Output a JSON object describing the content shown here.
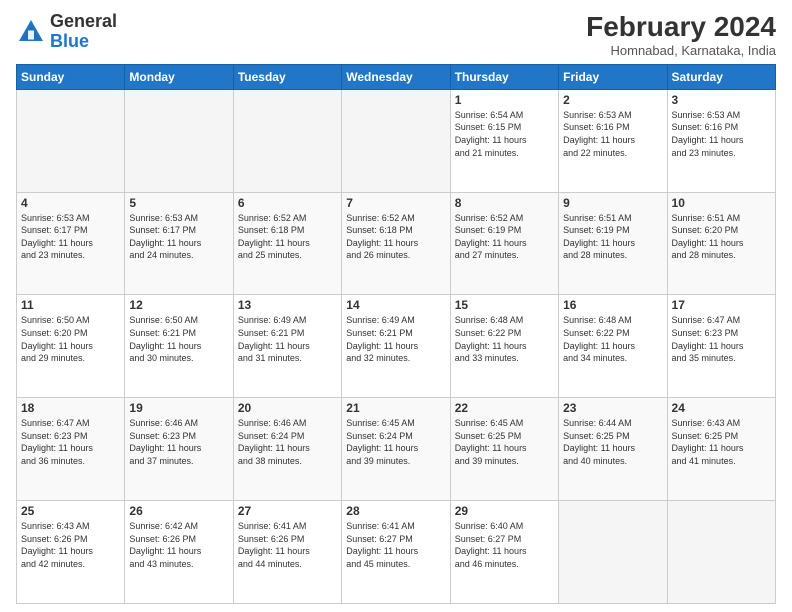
{
  "header": {
    "logo_general": "General",
    "logo_blue": "Blue",
    "month_year": "February 2024",
    "location": "Homnabad, Karnataka, India"
  },
  "days_of_week": [
    "Sunday",
    "Monday",
    "Tuesday",
    "Wednesday",
    "Thursday",
    "Friday",
    "Saturday"
  ],
  "weeks": [
    [
      {
        "day": "",
        "info": ""
      },
      {
        "day": "",
        "info": ""
      },
      {
        "day": "",
        "info": ""
      },
      {
        "day": "",
        "info": ""
      },
      {
        "day": "1",
        "info": "Sunrise: 6:54 AM\nSunset: 6:15 PM\nDaylight: 11 hours\nand 21 minutes."
      },
      {
        "day": "2",
        "info": "Sunrise: 6:53 AM\nSunset: 6:16 PM\nDaylight: 11 hours\nand 22 minutes."
      },
      {
        "day": "3",
        "info": "Sunrise: 6:53 AM\nSunset: 6:16 PM\nDaylight: 11 hours\nand 23 minutes."
      }
    ],
    [
      {
        "day": "4",
        "info": "Sunrise: 6:53 AM\nSunset: 6:17 PM\nDaylight: 11 hours\nand 23 minutes."
      },
      {
        "day": "5",
        "info": "Sunrise: 6:53 AM\nSunset: 6:17 PM\nDaylight: 11 hours\nand 24 minutes."
      },
      {
        "day": "6",
        "info": "Sunrise: 6:52 AM\nSunset: 6:18 PM\nDaylight: 11 hours\nand 25 minutes."
      },
      {
        "day": "7",
        "info": "Sunrise: 6:52 AM\nSunset: 6:18 PM\nDaylight: 11 hours\nand 26 minutes."
      },
      {
        "day": "8",
        "info": "Sunrise: 6:52 AM\nSunset: 6:19 PM\nDaylight: 11 hours\nand 27 minutes."
      },
      {
        "day": "9",
        "info": "Sunrise: 6:51 AM\nSunset: 6:19 PM\nDaylight: 11 hours\nand 28 minutes."
      },
      {
        "day": "10",
        "info": "Sunrise: 6:51 AM\nSunset: 6:20 PM\nDaylight: 11 hours\nand 28 minutes."
      }
    ],
    [
      {
        "day": "11",
        "info": "Sunrise: 6:50 AM\nSunset: 6:20 PM\nDaylight: 11 hours\nand 29 minutes."
      },
      {
        "day": "12",
        "info": "Sunrise: 6:50 AM\nSunset: 6:21 PM\nDaylight: 11 hours\nand 30 minutes."
      },
      {
        "day": "13",
        "info": "Sunrise: 6:49 AM\nSunset: 6:21 PM\nDaylight: 11 hours\nand 31 minutes."
      },
      {
        "day": "14",
        "info": "Sunrise: 6:49 AM\nSunset: 6:21 PM\nDaylight: 11 hours\nand 32 minutes."
      },
      {
        "day": "15",
        "info": "Sunrise: 6:48 AM\nSunset: 6:22 PM\nDaylight: 11 hours\nand 33 minutes."
      },
      {
        "day": "16",
        "info": "Sunrise: 6:48 AM\nSunset: 6:22 PM\nDaylight: 11 hours\nand 34 minutes."
      },
      {
        "day": "17",
        "info": "Sunrise: 6:47 AM\nSunset: 6:23 PM\nDaylight: 11 hours\nand 35 minutes."
      }
    ],
    [
      {
        "day": "18",
        "info": "Sunrise: 6:47 AM\nSunset: 6:23 PM\nDaylight: 11 hours\nand 36 minutes."
      },
      {
        "day": "19",
        "info": "Sunrise: 6:46 AM\nSunset: 6:23 PM\nDaylight: 11 hours\nand 37 minutes."
      },
      {
        "day": "20",
        "info": "Sunrise: 6:46 AM\nSunset: 6:24 PM\nDaylight: 11 hours\nand 38 minutes."
      },
      {
        "day": "21",
        "info": "Sunrise: 6:45 AM\nSunset: 6:24 PM\nDaylight: 11 hours\nand 39 minutes."
      },
      {
        "day": "22",
        "info": "Sunrise: 6:45 AM\nSunset: 6:25 PM\nDaylight: 11 hours\nand 39 minutes."
      },
      {
        "day": "23",
        "info": "Sunrise: 6:44 AM\nSunset: 6:25 PM\nDaylight: 11 hours\nand 40 minutes."
      },
      {
        "day": "24",
        "info": "Sunrise: 6:43 AM\nSunset: 6:25 PM\nDaylight: 11 hours\nand 41 minutes."
      }
    ],
    [
      {
        "day": "25",
        "info": "Sunrise: 6:43 AM\nSunset: 6:26 PM\nDaylight: 11 hours\nand 42 minutes."
      },
      {
        "day": "26",
        "info": "Sunrise: 6:42 AM\nSunset: 6:26 PM\nDaylight: 11 hours\nand 43 minutes."
      },
      {
        "day": "27",
        "info": "Sunrise: 6:41 AM\nSunset: 6:26 PM\nDaylight: 11 hours\nand 44 minutes."
      },
      {
        "day": "28",
        "info": "Sunrise: 6:41 AM\nSunset: 6:27 PM\nDaylight: 11 hours\nand 45 minutes."
      },
      {
        "day": "29",
        "info": "Sunrise: 6:40 AM\nSunset: 6:27 PM\nDaylight: 11 hours\nand 46 minutes."
      },
      {
        "day": "",
        "info": ""
      },
      {
        "day": "",
        "info": ""
      }
    ]
  ]
}
